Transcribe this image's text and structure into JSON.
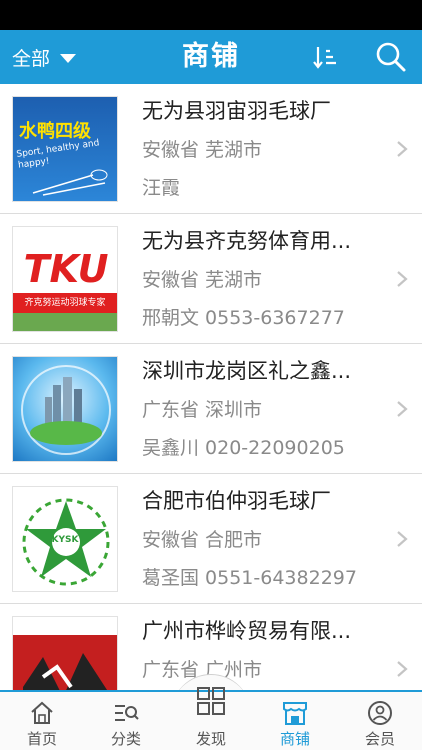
{
  "header": {
    "filter_label": "全部",
    "title": "商铺"
  },
  "shops": [
    {
      "name": "无为县羽宙羽毛球厂",
      "region": "安徽省 芜湖市",
      "contact": "汪霞",
      "thumb": {
        "text": "水鸭四级",
        "subtext": "Sport, healthy and happy!"
      }
    },
    {
      "name": "无为县齐克努体育用...",
      "region": "安徽省 芜湖市",
      "contact": "邢朝文  0553-6367277",
      "thumb": {
        "text": "TKU",
        "subtext": "齐克努运动羽球专家"
      }
    },
    {
      "name": "深圳市龙岗区礼之鑫...",
      "region": "广东省 深圳市",
      "contact": "吴鑫川  020-22090205",
      "thumb": {
        "text": "",
        "subtext": ""
      }
    },
    {
      "name": "合肥市伯仲羽毛球厂",
      "region": "安徽省 合肥市",
      "contact": "葛圣国  0551-64382297",
      "thumb": {
        "text": "KYSK",
        "subtext": ""
      }
    },
    {
      "name": "广州市桦岭贸易有限...",
      "region": "广东省 广州市",
      "contact": "",
      "thumb": {
        "text": "",
        "subtext": ""
      }
    }
  ],
  "tabs": [
    {
      "label": "首页",
      "icon": "home-icon"
    },
    {
      "label": "分类",
      "icon": "category-icon"
    },
    {
      "label": "发现",
      "icon": "discover-grid-icon"
    },
    {
      "label": "商铺",
      "icon": "shop-icon",
      "active": true
    },
    {
      "label": "会员",
      "icon": "member-icon"
    }
  ],
  "colors": {
    "accent": "#1f9bd7",
    "secondary_text": "#8a8a8a"
  }
}
